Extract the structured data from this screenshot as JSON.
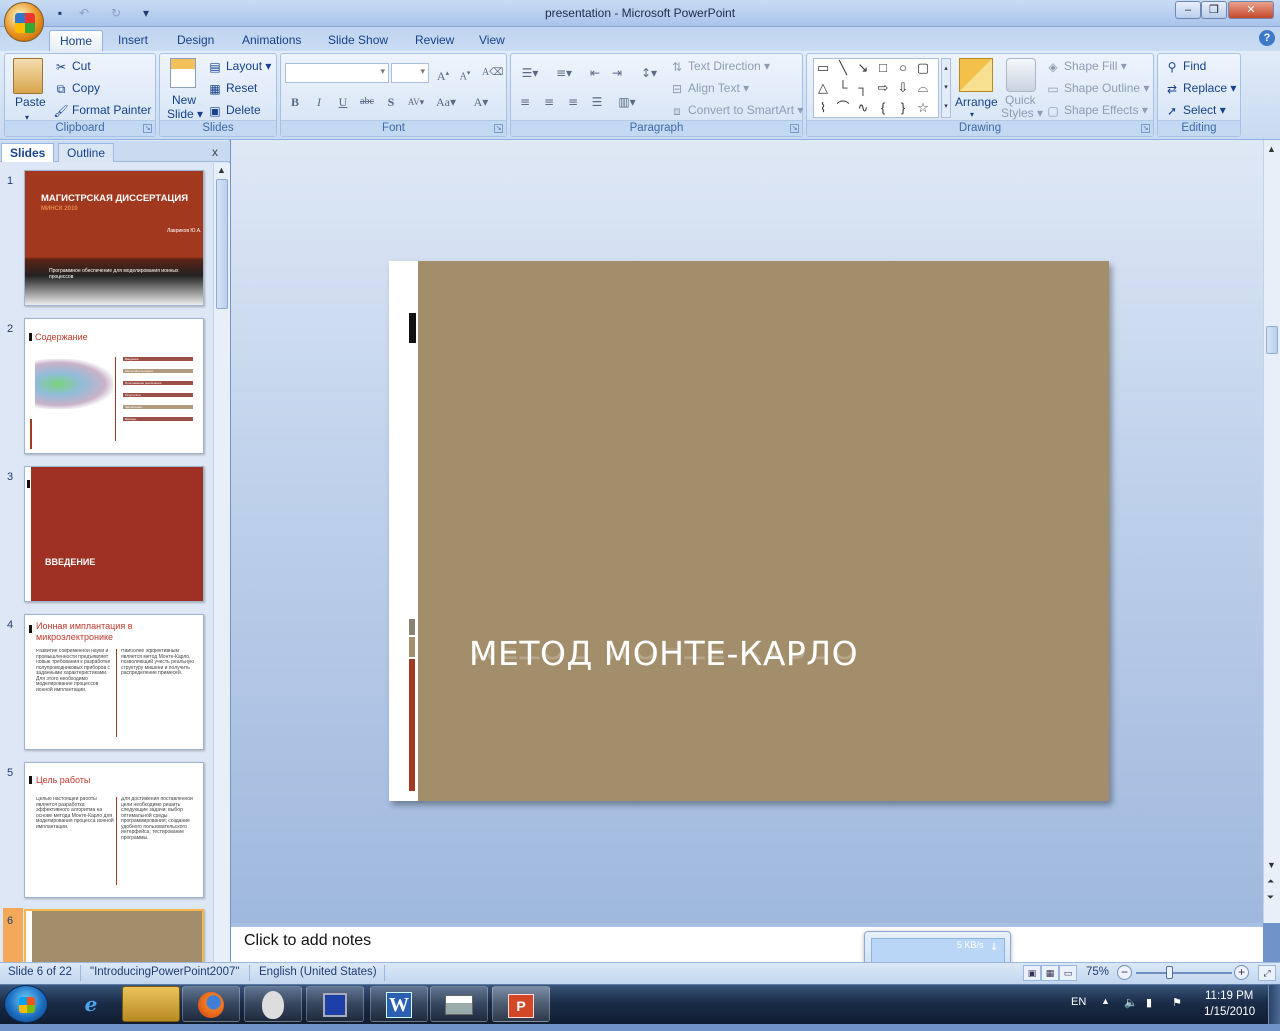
{
  "window": {
    "title": "presentation - Microsoft PowerPoint"
  },
  "quick_access": [
    {
      "name": "save-icon",
      "glyph": "💾"
    },
    {
      "name": "undo-icon",
      "glyph": "↶"
    },
    {
      "name": "redo-icon",
      "glyph": "↻"
    },
    {
      "name": "customize-qat-icon",
      "glyph": "▾"
    }
  ],
  "tabs": [
    "Home",
    "Insert",
    "Design",
    "Animations",
    "Slide Show",
    "Review",
    "View"
  ],
  "active_tab": "Home",
  "ribbon": {
    "clipboard": {
      "label": "Clipboard",
      "paste": "Paste",
      "cut": "Cut",
      "copy": "Copy",
      "format_painter": "Format Painter"
    },
    "slides": {
      "label": "Slides",
      "new_slide_1": "New",
      "new_slide_2": "Slide",
      "layout": "Layout",
      "reset": "Reset",
      "delete": "Delete"
    },
    "font": {
      "label": "Font",
      "font_name_value": "",
      "font_size_value": ""
    },
    "paragraph": {
      "label": "Paragraph",
      "text_direction": "Text Direction",
      "align_text": "Align Text",
      "convert_smartart": "Convert to SmartArt"
    },
    "drawing": {
      "label": "Drawing",
      "arrange": "Arrange",
      "quick_styles_1": "Quick",
      "quick_styles_2": "Styles",
      "shape_fill": "Shape Fill",
      "shape_outline": "Shape Outline",
      "shape_effects": "Shape Effects"
    },
    "editing": {
      "label": "Editing",
      "find": "Find",
      "replace": "Replace",
      "select": "Select"
    }
  },
  "pane": {
    "tab_slides": "Slides",
    "tab_outline": "Outline",
    "close": "x"
  },
  "thumbnails": [
    {
      "num": "1",
      "title": "МАГИСТРСКАЯ ДИССЕРТАЦИЯ",
      "subtitle": "МИНСК 2010",
      "author": "Лавриков Ю.А.",
      "caption": "Программное обеспечение для моделирования ионных процессов"
    },
    {
      "num": "2",
      "title": "Содержание",
      "items": [
        "Введение",
        "Метод Монте-Карло",
        "Программная реализация",
        "Результаты",
        "Заключение",
        "Выводы"
      ]
    },
    {
      "num": "3",
      "title": "ВВЕДЕНИЕ"
    },
    {
      "num": "4",
      "title": "Ионная имплантация в микроэлектронике",
      "body_left": "Развитие современной науки и промышленности предъявляет новые требования к разработке полупроводниковых приборов с заданными характеристиками. Для этого необходимо моделирование процессов ионной имплантации.",
      "body_right": "Наиболее эффективным является метод Монте-Карло, позволяющий учесть реальную структуру мишени и получить распределение примесей."
    },
    {
      "num": "5",
      "title": "Цель работы",
      "body_left": "Целью настоящей работы является разработка эффективного алгоритма на основе метода Монте-Карло для моделирования процесса ионной имплантации.",
      "body_right": "Для достижения поставленной цели необходимо решить следующие задачи: выбор оптимальной среды программирования; создание удобного пользовательского интерфейса; тестирование программы."
    },
    {
      "num": "6",
      "title": ""
    }
  ],
  "slide": {
    "title": "Метод Монте-Карло",
    "bg_color": "#a28e6b",
    "strip_color": "#ffffff",
    "accent_bar_color": "#9e3b22"
  },
  "notes": {
    "placeholder": "Click to add notes"
  },
  "network_widget": {
    "speed": "5 KB/s"
  },
  "status": {
    "slide_info": "Slide 6 of 22",
    "theme": "\"IntroducingPowerPoint2007\"",
    "language": "English (United States)",
    "zoom": "75%"
  },
  "taskbar": {
    "apps": [
      {
        "name": "ie-icon",
        "glyph": "e"
      },
      {
        "name": "explorer-icon",
        "glyph": "📁"
      },
      {
        "name": "firefox-icon",
        "glyph": "🦊"
      },
      {
        "name": "alien-app-icon",
        "glyph": "👽"
      },
      {
        "name": "save-app-icon",
        "glyph": "💾"
      },
      {
        "name": "word-icon",
        "glyph": "W"
      },
      {
        "name": "printer-icon",
        "glyph": "🖨"
      },
      {
        "name": "powerpoint-icon",
        "glyph": "P"
      }
    ],
    "language": "EN",
    "time": "11:19 PM",
    "date": "1/15/2010"
  }
}
